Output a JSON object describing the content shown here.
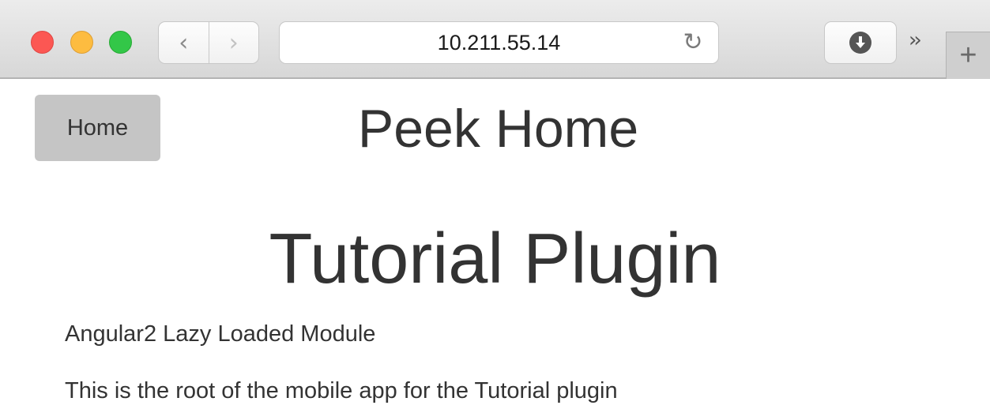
{
  "browser": {
    "address": "10.211.55.14",
    "icons": {
      "back": "chevron-left-icon",
      "forward": "chevron-right-icon",
      "reload": "reload-icon",
      "download": "download-icon",
      "overflow": "double-chevron-icon",
      "new_tab": "plus-icon"
    }
  },
  "page": {
    "home_button": "Home",
    "site_title": "Peek Home",
    "page_title": "Tutorial Plugin",
    "paragraphs": [
      "Angular2 Lazy Loaded Module",
      "This is the root of the mobile app for the Tutorial plugin"
    ]
  },
  "colors": {
    "text": "#333333",
    "home_button_bg": "#c5c5c5",
    "close": "#fc5753",
    "minimize": "#fdbc40",
    "zoom": "#33c748"
  }
}
